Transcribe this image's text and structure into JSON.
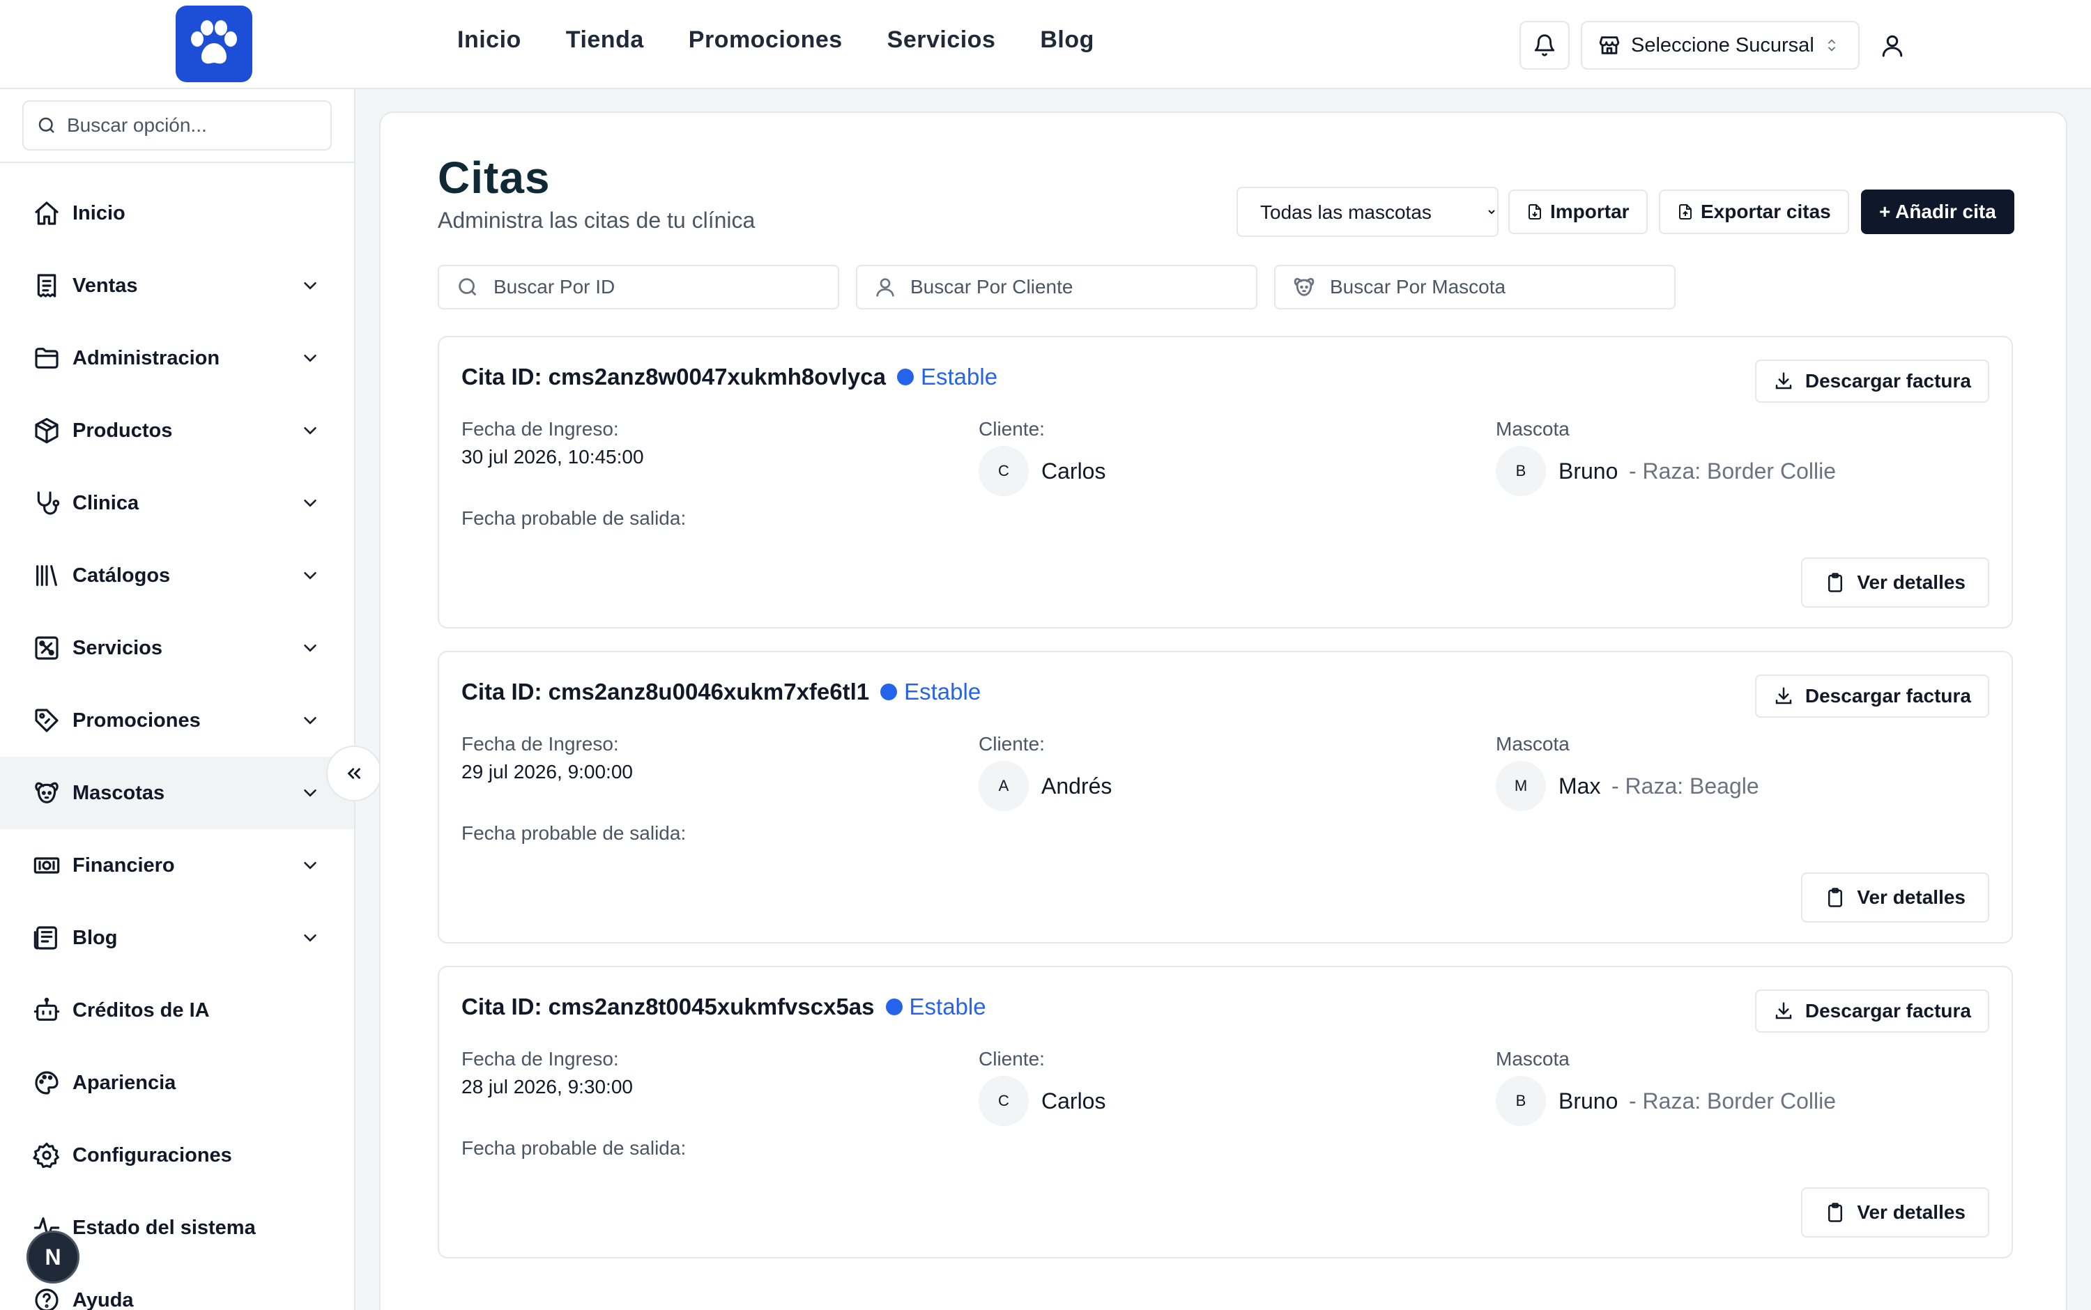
{
  "nav": {
    "links": [
      "Inicio",
      "Tienda",
      "Promociones",
      "Servicios",
      "Blog"
    ],
    "branch_label": "Seleccione Sucursal",
    "brand_color": "#1d4ed8"
  },
  "sidebar": {
    "search_placeholder": "Buscar opción...",
    "items": [
      {
        "label": "Inicio",
        "icon": "home-icon",
        "expandable": false
      },
      {
        "label": "Ventas",
        "icon": "receipt-icon",
        "expandable": true
      },
      {
        "label": "Administracion",
        "icon": "folder-icon",
        "expandable": true
      },
      {
        "label": "Productos",
        "icon": "package-icon",
        "expandable": true
      },
      {
        "label": "Clinica",
        "icon": "stethoscope-icon",
        "expandable": true
      },
      {
        "label": "Catálogos",
        "icon": "library-icon",
        "expandable": true
      },
      {
        "label": "Servicios",
        "icon": "service-icon",
        "expandable": true
      },
      {
        "label": "Promociones",
        "icon": "tag-icon",
        "expandable": true
      },
      {
        "label": "Mascotas",
        "icon": "dog-icon",
        "expandable": true,
        "active": true
      },
      {
        "label": "Financiero",
        "icon": "banknote-icon",
        "expandable": true
      },
      {
        "label": "Blog",
        "icon": "newspaper-icon",
        "expandable": true
      },
      {
        "label": "Créditos de IA",
        "icon": "bot-icon",
        "expandable": false
      },
      {
        "label": "Apariencia",
        "icon": "palette-icon",
        "expandable": false
      },
      {
        "label": "Configuraciones",
        "icon": "gear-icon",
        "expandable": false
      },
      {
        "label": "Estado del sistema",
        "icon": "activity-icon",
        "expandable": false
      },
      {
        "label": "Ayuda",
        "icon": "help-icon",
        "expandable": false
      }
    ],
    "badge_letter": "N"
  },
  "page": {
    "title": "Citas",
    "subtitle": "Administra las citas de tu clínica",
    "pet_filter": "Todas las mascotas",
    "import_label": "Importar",
    "export_label": "Exportar citas",
    "add_label": "+ Añadir cita",
    "search_id_placeholder": "Buscar Por ID",
    "search_client_placeholder": "Buscar Por Cliente",
    "search_pet_placeholder": "Buscar Por Mascota"
  },
  "labels": {
    "entry": "Fecha de Ingreso:",
    "client": "Cliente:",
    "pet": "Mascota",
    "exit": "Fecha probable de salida:",
    "invoice": "Descargar factura",
    "details": "Ver detalles",
    "status_color": "#2563eb"
  },
  "appointments": [
    {
      "id": "Cita ID: cms2anz8w0047xukmh8ovlyca",
      "status": "Estable",
      "entry_date": "30 jul 2026, 10:45:00",
      "client_initial": "C",
      "client": "Carlos",
      "pet_initial": "B",
      "pet": "Bruno",
      "breed": "- Raza: Border Collie"
    },
    {
      "id": "Cita ID: cms2anz8u0046xukm7xfe6tl1",
      "status": "Estable",
      "entry_date": "29 jul 2026, 9:00:00",
      "client_initial": "A",
      "client": "Andrés",
      "pet_initial": "M",
      "pet": "Max",
      "breed": "- Raza: Beagle"
    },
    {
      "id": "Cita ID: cms2anz8t0045xukmfvscx5as",
      "status": "Estable",
      "entry_date": "28 jul 2026, 9:30:00",
      "client_initial": "C",
      "client": "Carlos",
      "pet_initial": "B",
      "pet": "Bruno",
      "breed": "- Raza: Border Collie"
    }
  ]
}
